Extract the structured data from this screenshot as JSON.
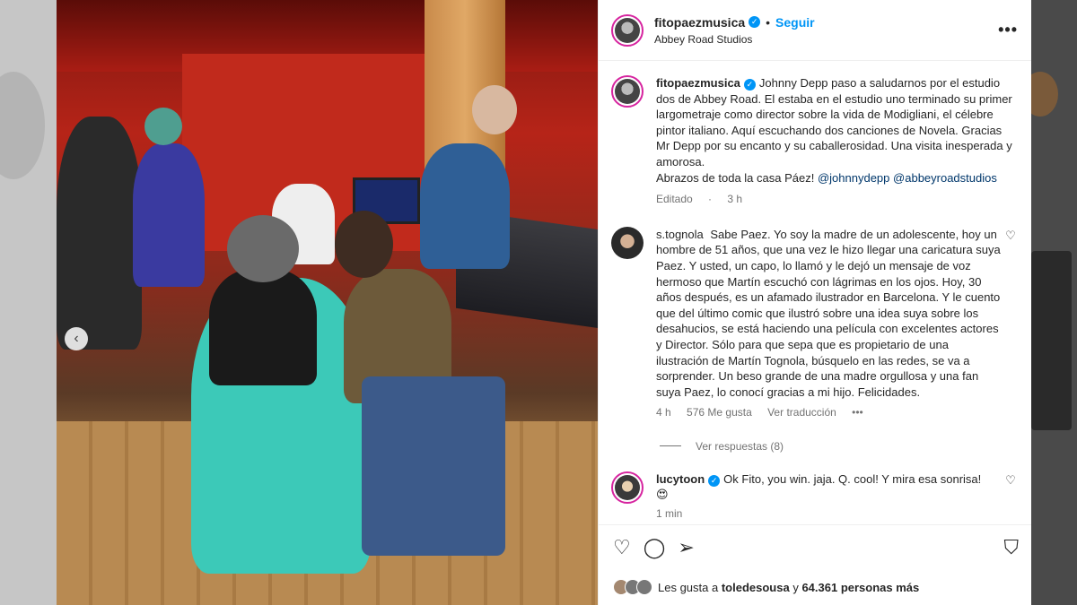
{
  "post": {
    "username": "fitopaezmusica",
    "separator": "•",
    "follow_label": "Seguir",
    "location": "Abbey Road Studios",
    "more_label": "•••",
    "caption": "Johnny Depp paso a saludarnos por el estudio dos de Abbey Road. El estaba en el estudio uno terminado su primer largometraje como director sobre la vida de Modigliani, el célebre pintor italiano. Aquí escuchando dos canciones de Novela. Gracias Mr Depp por su encanto y su caballerosidad. Una visita inesperada y amorosa.",
    "caption_line2": "Abrazos de toda la casa Páez!",
    "mention_1": "@johnnydepp",
    "mention_2": "@abbeyroadstudios",
    "edited": "Editado",
    "edited_dot": "·",
    "edited_time": "3 h",
    "carousel_prev": "‹"
  },
  "comments": [
    {
      "username": "s.tognola",
      "text": "Sabe Paez. Yo soy la madre de un adolescente, hoy un hombre de 51 años, que una vez le hizo llegar una caricatura suya Paez. Y usted, un capo, lo llamó y le dejó un mensaje de voz hermoso que Martín escuchó con lágrimas en los ojos. Hoy, 30 años después, es un afamado ilustrador en Barcelona. Y le cuento que del último comic que ilustró sobre una idea suya sobre los desahucios, se está haciendo una película con excelentes actores y Director. Sólo para que sepa que es propietario de una ilustración de Martín Tognola, búsquelo en las redes, se va a sorprender. Un beso grande de una madre orgullosa y una fan suya Paez, lo conocí gracias a mi hijo. Felicidades.",
      "time": "4 h",
      "likes": "576 Me gusta",
      "translate": "Ver traducción",
      "more": "•••",
      "replies": "Ver respuestas (8)"
    },
    {
      "username": "lucytoon",
      "text": "Ok Fito, you win. jaja. Q. cool! Y mira esa sonrisa!",
      "emoji": "😍",
      "time": "1 min"
    }
  ],
  "likes_bar": {
    "prefix": "Les gusta a",
    "user": "toledesousa",
    "mid": "y",
    "count": "64.361 personas más"
  },
  "icons": {
    "like": "♡",
    "comment": "◯",
    "share": "➢",
    "save": "⛉",
    "comment_like": "♡",
    "verified": "✓"
  },
  "colors": {
    "accent": "#0095f6",
    "mention": "#00376b",
    "muted": "#737373"
  }
}
